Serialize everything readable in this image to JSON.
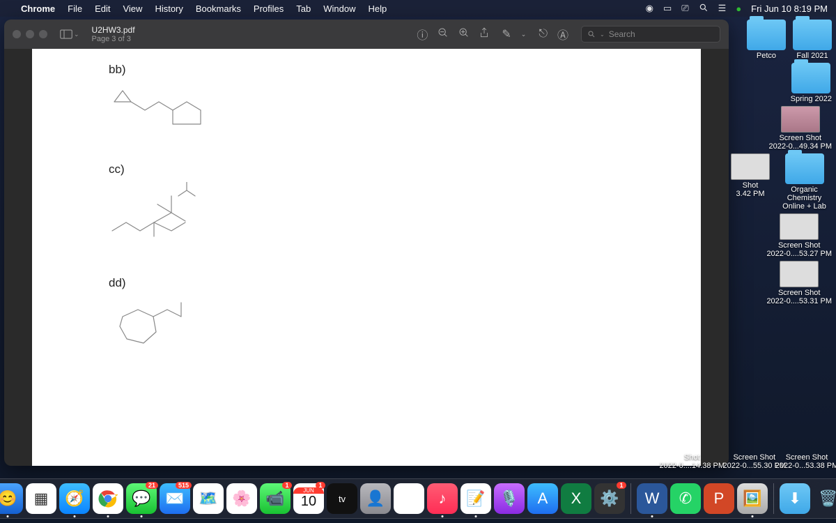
{
  "menubar": {
    "app": "Chrome",
    "items": [
      "File",
      "Edit",
      "View",
      "History",
      "Bookmarks",
      "Profiles",
      "Tab",
      "Window",
      "Help"
    ],
    "clock": "Fri Jun 10  8:19 PM"
  },
  "preview": {
    "title": "U2HW3.pdf",
    "subtitle": "Page 3 of 3",
    "search_placeholder": "Search",
    "problems": {
      "bb": "bb)",
      "cc": "cc)",
      "dd": "dd)"
    }
  },
  "desktop": {
    "folders": [
      {
        "label": "Petco"
      },
      {
        "label": "Fall 2021"
      },
      {
        "label": "Spring 2022"
      },
      {
        "label": "Organic Chemistry Online + Lab"
      }
    ],
    "shots": [
      {
        "l1": "Screen Shot",
        "l2": "2022-0...49.34 PM"
      },
      {
        "l1": "Shot",
        "l2": "3.42 PM"
      },
      {
        "l1": "Screen Shot",
        "l2": "2022-0....53.27 PM"
      },
      {
        "l1": "Screen Shot",
        "l2": "2022-0....53.31 PM"
      },
      {
        "l1": "Shot",
        "l2": "2022-0....14.38 PM"
      },
      {
        "l1": "Screen Shot",
        "l2": "2022-0...55.30 PM"
      },
      {
        "l1": "Screen Shot",
        "l2": "2022-0...53.38 PM"
      }
    ]
  },
  "dock": {
    "cal_month": "JUN",
    "cal_day": "10",
    "badges": {
      "messages": "21",
      "mail": "515",
      "facetime": "1",
      "cal": "1",
      "settings": "1"
    }
  }
}
